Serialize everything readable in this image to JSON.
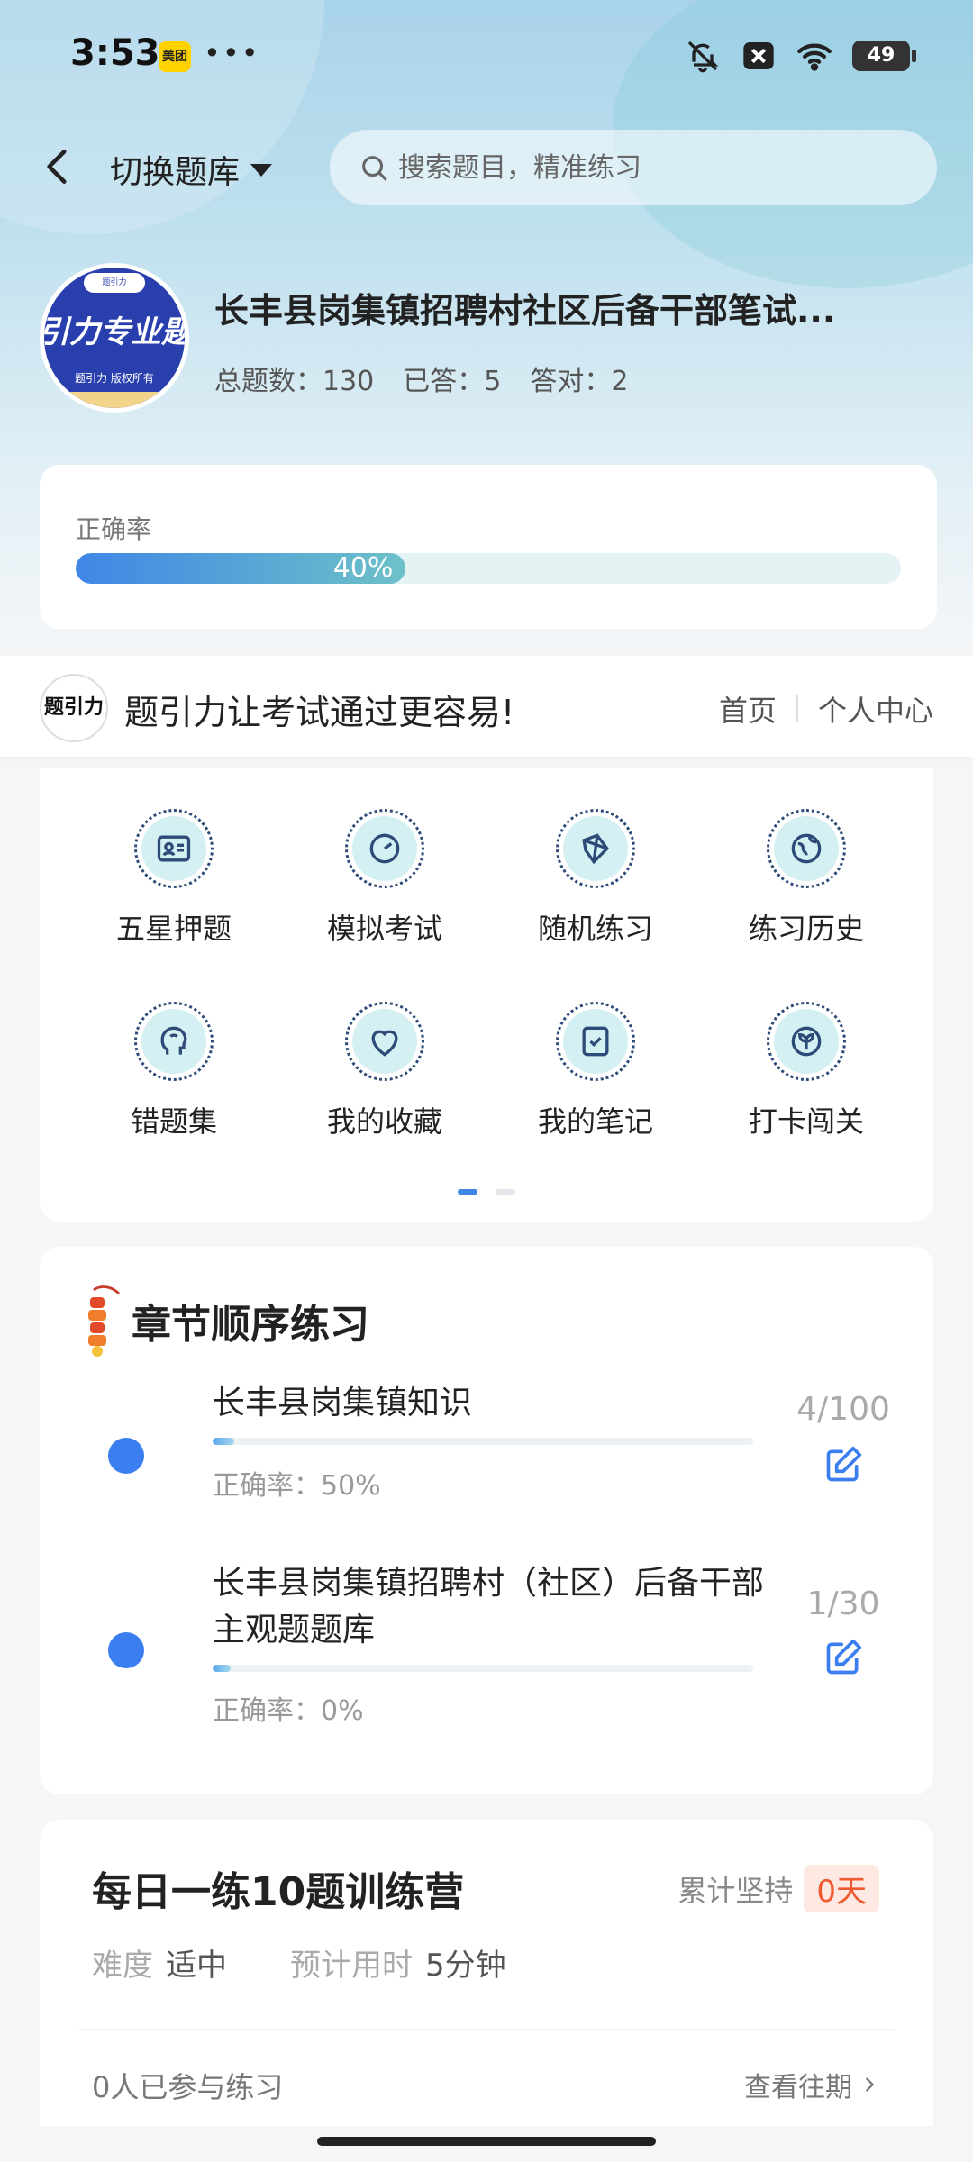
{
  "status": {
    "time": "3:53",
    "app_badge": "美团",
    "more": "•••",
    "battery": "49"
  },
  "nav": {
    "switch_label": "切换题库",
    "search_placeholder": "搜索题目，精准练习"
  },
  "bank": {
    "logo_text": "引力专业题",
    "logo_tag": "题引力",
    "logo_small": "题引力 版权所有",
    "title": "长丰县岗集镇招聘村社区后备干部笔试...",
    "stats": {
      "total": "总题数：130",
      "answered": "已答：5",
      "correct": "答对：2"
    }
  },
  "accuracy": {
    "label": "正确率",
    "value": 0.4,
    "text": "40%"
  },
  "promo": {
    "logo": "题引力",
    "text": "题引力让考试通过更容易!",
    "link_home": "首页",
    "link_me": "个人中心"
  },
  "features": [
    {
      "label": "五星押题",
      "icon": "id-card-icon"
    },
    {
      "label": "模拟考试",
      "icon": "gauge-icon"
    },
    {
      "label": "随机练习",
      "icon": "network-icon"
    },
    {
      "label": "练习历史",
      "icon": "globe-icon"
    },
    {
      "label": "错题集",
      "icon": "head-icon"
    },
    {
      "label": "我的收藏",
      "icon": "heart-icon"
    },
    {
      "label": "我的笔记",
      "icon": "note-check-icon"
    },
    {
      "label": "打卡闯关",
      "icon": "leaf-icon"
    }
  ],
  "pager": {
    "pages": 2,
    "active": 0
  },
  "chapters": {
    "title": "章节顺序练习",
    "items": [
      {
        "name": "长丰县岗集镇知识",
        "rate": "正确率：50%",
        "count": "4/100",
        "progress": 0.04
      },
      {
        "name": "长丰县岗集镇招聘村（社区）后备干部主观题题库",
        "rate": "正确率：0%",
        "count": "1/30",
        "progress": 0.033
      }
    ]
  },
  "daily": {
    "title": "每日一练10题训练营",
    "keep_label": "累计坚持",
    "keep_days": "0天",
    "difficulty_label": "难度",
    "difficulty": "适中",
    "time_label": "预计用时",
    "time": "5分钟",
    "joined": "0人已参与练习",
    "past": "查看往期"
  },
  "colors": {
    "accent": "#3f86e6",
    "dot": "#3a7ef0",
    "badge": "#f0582d"
  }
}
